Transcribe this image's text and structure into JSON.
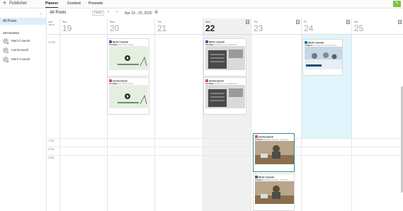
{
  "app": {
    "brand": "Publisher"
  },
  "nav": {
    "tabs": [
      "Planner",
      "Content",
      "Promote"
    ]
  },
  "sidebar": {
    "all_posts": "All Posts",
    "networks_title": "NETWORKS",
    "networks": [
      {
        "label": "Merit Cowork",
        "dot": "#3b5998"
      },
      {
        "label": "meritcowork",
        "dot": "#d6456c"
      },
      {
        "label": "Merit Cowork",
        "dot": "#0077b5"
      }
    ]
  },
  "toolbar": {
    "title": "All Posts",
    "today": "TODAY",
    "range": "Apr 19 - 25, 2020"
  },
  "calendar": {
    "gmt": "GMT\n-06:00",
    "days": [
      {
        "name": "Sun",
        "num": "19"
      },
      {
        "name": "Mon",
        "num": "20"
      },
      {
        "name": "Tue",
        "num": "21"
      },
      {
        "name": "Wed",
        "num": "22"
      },
      {
        "name": "Thu",
        "num": "23"
      },
      {
        "name": "Fri",
        "num": "24"
      },
      {
        "name": "Sat",
        "num": "25"
      }
    ],
    "times": [
      "12 PM",
      "1 PM",
      "2 PM",
      "3 PM"
    ]
  },
  "posts": [
    {
      "acct": "Merit Cowork",
      "time": "12:04pm",
      "text": "Our third virtual...",
      "net": "#3b5998",
      "img": "nourish"
    },
    {
      "acct": "meritcowork",
      "time": "12:04pm",
      "text": "Our third virtual...",
      "net": "#d6456c",
      "img": "nourish"
    },
    {
      "acct": "Merit Cowork",
      "time": "12:00pm",
      "text": "Words for our Wedneso",
      "net": "#3b5998",
      "img": "letterboard"
    },
    {
      "acct": "meritcowork",
      "time": "12:00pm",
      "text": "Words for our Wedneso",
      "net": "#d6456c",
      "img": "letterboard"
    },
    {
      "acct": "Merit Cowork",
      "time": "4:18pm",
      "text": "As most of us know by no",
      "net": "#0077b5",
      "img": "office"
    },
    {
      "acct": "meritcowork",
      "time": "2:00pm",
      "text": "Building a brand - it's all at",
      "net": "#d6456c",
      "img": "desk"
    },
    {
      "acct": "Merit Cowork",
      "time": "2:00pm",
      "text": "Building a brand - it's all at",
      "net": "#3b5998",
      "img": "desk"
    }
  ]
}
